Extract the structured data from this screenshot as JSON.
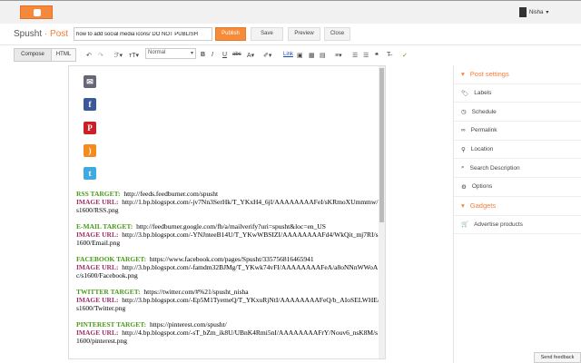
{
  "header": {
    "user": "Nisha"
  },
  "postbar": {
    "blog_name": "Spusht",
    "separator": " · ",
    "section": "Post",
    "title_value": "how to add social media icons/ DO NOT PUBLISH",
    "publish": "Publish",
    "save": "Save",
    "preview": "Preview",
    "close": "Close"
  },
  "toolbar": {
    "compose": "Compose",
    "html": "HTML",
    "font_size_select": "Normal",
    "link": "Link"
  },
  "editor": {
    "icons": [
      "email-icon",
      "facebook-icon",
      "pinterest-icon",
      "rss-icon",
      "twitter-icon"
    ],
    "entries": [
      {
        "label": "RSS TARGET:",
        "target": "http://feeds.feedburner.com/spusht",
        "img_label": "IMAGE URL:",
        "img": "http://1.bp.blogspot.com/-jv7Nn3SerHk/T_YKxH4_6jI/AAAAAAAAFeI/sKRmoXUmmmw/s1600/RSS.png"
      },
      {
        "label": "E-MAIL TARGET:",
        "target": "http://feedburner.google.com/fb/a/mailverify?uri=spusht&loc=en_US",
        "img_label": "IMAGE URL:",
        "img": "http://3.bp.blogspot.com/-YNJnteeB14U/T_YKwWBSIZI/AAAAAAAAFd4/WkQit_mj7RI/s1600/Email.png"
      },
      {
        "label": "FACEBOOK TARGET:",
        "target": "https://www.facebook.com/pages/Spusht/335756816465941",
        "img_label": "IMAGE URL:",
        "img": "http://3.bp.blogspot.com/-famdm32BJMg/T_YKwk74vFI/AAAAAAAAFeA/a8oNNnWWoAc/s1600/Facebook.png"
      },
      {
        "label": "TWITTER TARGET:",
        "target": "https://twitter.com/#%21/spusht_nisha",
        "img_label": "IMAGE URL:",
        "img": "http://3.bp.blogspot.com/-Ep5M1TyemeQ/T_YKxuRjNtI/AAAAAAAAFeQ/b_AIoSELWHE/s1600/Twitter.png"
      },
      {
        "label": "PINTEREST TARGET:",
        "target": "https://pinterest.com/spusht/",
        "img_label": "IMAGE URL:",
        "img": "http://4.bp.blogspot.com/-sT_bZm_ik8U/UBnK4Rmi5nI/AAAAAAAAFrY/Nouv6_nsK8M/s1600/pinterest.png"
      }
    ]
  },
  "sidebar": {
    "post_settings": "Post settings",
    "items": [
      "Labels",
      "Schedule",
      "Permalink",
      "Location",
      "Search Description",
      "Options"
    ],
    "gadgets": "Gadgets",
    "gadget_items": [
      "Advertise products"
    ]
  },
  "feedback": "Send feedback",
  "colors": {
    "accent": "#f57d37",
    "target_label": "#4a9a1a",
    "image_label": "#a0306a"
  }
}
